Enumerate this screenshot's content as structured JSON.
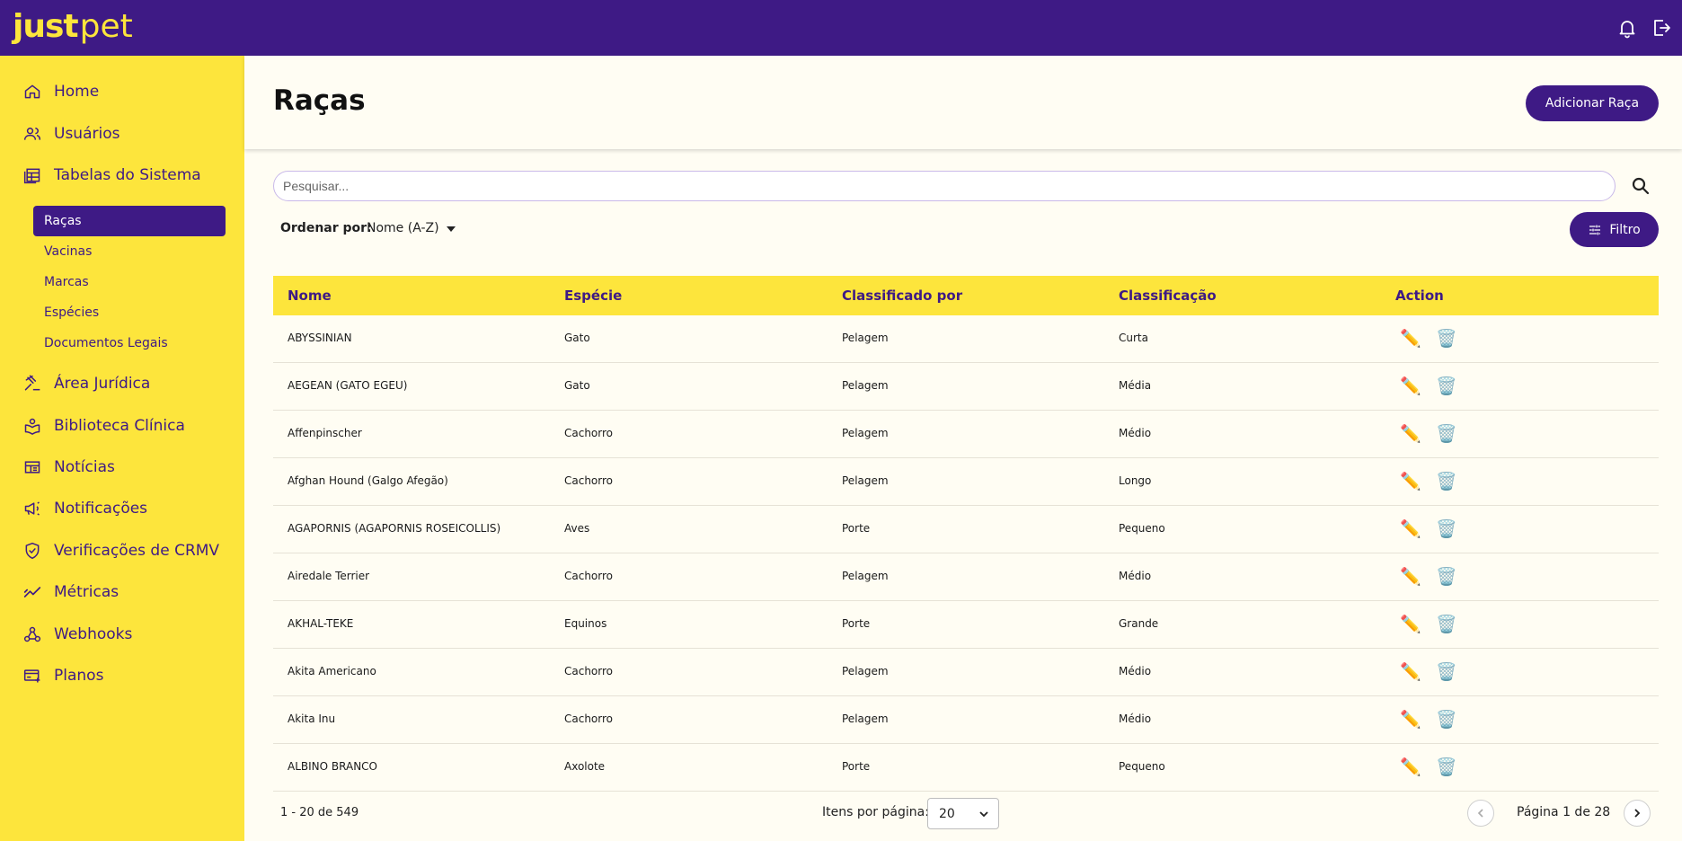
{
  "brand": {
    "part1": "just",
    "part2": "pet"
  },
  "colors": {
    "primary": "#3e1a85",
    "accent": "#fde53c",
    "background": "#fffdf3"
  },
  "header": {
    "icons": [
      "bell-icon",
      "logout-icon"
    ]
  },
  "sidebar": {
    "items": [
      {
        "label": "Home",
        "icon": "home-icon"
      },
      {
        "label": "Usuários",
        "icon": "users-icon"
      },
      {
        "label": "Tabelas do Sistema",
        "icon": "table-icon"
      },
      {
        "label": "Área Jurídica",
        "icon": "gavel-icon"
      },
      {
        "label": "Biblioteca Clínica",
        "icon": "library-icon"
      },
      {
        "label": "Notícias",
        "icon": "news-icon"
      },
      {
        "label": "Notificações",
        "icon": "megaphone-icon"
      },
      {
        "label": "Verificações de CRMV",
        "icon": "shield-check-icon"
      },
      {
        "label": "Métricas",
        "icon": "metrics-icon"
      },
      {
        "label": "Webhooks",
        "icon": "webhook-icon"
      },
      {
        "label": "Planos",
        "icon": "plans-icon"
      }
    ],
    "subitems": [
      "Raças",
      "Vacinas",
      "Marcas",
      "Espécies",
      "Documentos Legais"
    ],
    "active_subitem": "Raças"
  },
  "page": {
    "title": "Raças",
    "add_button": "Adicionar Raça"
  },
  "search": {
    "placeholder": "Pesquisar..."
  },
  "sort": {
    "label": "Ordenar por:",
    "value": "Nome (A-Z)"
  },
  "filter": {
    "label": "Filtro"
  },
  "table": {
    "columns": [
      "Nome",
      "Espécie",
      "Classificado por",
      "Classificação",
      "Action"
    ],
    "rows": [
      [
        "ABYSSINIAN",
        "Gato",
        "Pelagem",
        "Curta"
      ],
      [
        "AEGEAN (GATO EGEU)",
        "Gato",
        "Pelagem",
        "Média"
      ],
      [
        "Affenpinscher",
        "Cachorro",
        "Pelagem",
        "Médio"
      ],
      [
        "Afghan Hound (Galgo Afegão)",
        "Cachorro",
        "Pelagem",
        "Longo"
      ],
      [
        "AGAPORNIS (AGAPORNIS ROSEICOLLIS)",
        "Aves",
        "Porte",
        "Pequeno"
      ],
      [
        "Airedale Terrier",
        "Cachorro",
        "Pelagem",
        "Médio"
      ],
      [
        "AKHAL-TEKE",
        "Equinos",
        "Porte",
        "Grande"
      ],
      [
        "Akita Americano",
        "Cachorro",
        "Pelagem",
        "Médio"
      ],
      [
        "Akita Inu",
        "Cachorro",
        "Pelagem",
        "Médio"
      ],
      [
        "ALBINO BRANCO",
        "Axolote",
        "Porte",
        "Pequeno"
      ]
    ],
    "actions": {
      "edit": "✏️",
      "delete": "🗑️"
    }
  },
  "pagination": {
    "range": "1 - 20 de 549",
    "per_page_label": "Itens por página:",
    "per_page_value": "20",
    "page_label": "Página 1 de 28"
  }
}
